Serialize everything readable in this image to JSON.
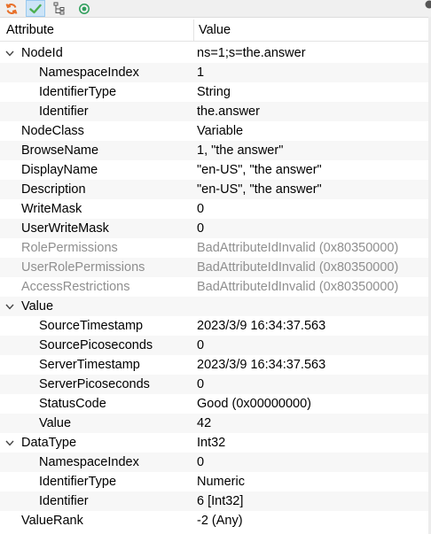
{
  "toolbar": {
    "buttons": [
      {
        "icon": "refresh-icon"
      },
      {
        "icon": "checkmark-icon",
        "active": true
      },
      {
        "icon": "tree-view-icon"
      },
      {
        "icon": "radio-target-icon"
      }
    ]
  },
  "header": {
    "attribute": "Attribute",
    "value": "Value"
  },
  "rows": [
    {
      "name": "NodeId",
      "value": "ns=1;s=the.answer",
      "level": 0,
      "expander": "expanded"
    },
    {
      "name": "NamespaceIndex",
      "value": "1",
      "level": 1
    },
    {
      "name": "IdentifierType",
      "value": "String",
      "level": 1
    },
    {
      "name": "Identifier",
      "value": "the.answer",
      "level": 1
    },
    {
      "name": "NodeClass",
      "value": "Variable",
      "level": 0
    },
    {
      "name": "BrowseName",
      "value": "1, \"the answer\"",
      "level": 0
    },
    {
      "name": "DisplayName",
      "value": "\"en-US\", \"the answer\"",
      "level": 0
    },
    {
      "name": "Description",
      "value": "\"en-US\", \"the answer\"",
      "level": 0
    },
    {
      "name": "WriteMask",
      "value": "0",
      "level": 0
    },
    {
      "name": "UserWriteMask",
      "value": "0",
      "level": 0
    },
    {
      "name": "RolePermissions",
      "value": "BadAttributeIdInvalid (0x80350000)",
      "level": 0,
      "disabled": true
    },
    {
      "name": "UserRolePermissions",
      "value": "BadAttributeIdInvalid (0x80350000)",
      "level": 0,
      "disabled": true
    },
    {
      "name": "AccessRestrictions",
      "value": "BadAttributeIdInvalid (0x80350000)",
      "level": 0,
      "disabled": true
    },
    {
      "name": "Value",
      "value": "",
      "level": 0,
      "expander": "expanded"
    },
    {
      "name": "SourceTimestamp",
      "value": "2023/3/9 16:34:37.563",
      "level": 1
    },
    {
      "name": "SourcePicoseconds",
      "value": "0",
      "level": 1
    },
    {
      "name": "ServerTimestamp",
      "value": "2023/3/9 16:34:37.563",
      "level": 1
    },
    {
      "name": "ServerPicoseconds",
      "value": "0",
      "level": 1
    },
    {
      "name": "StatusCode",
      "value": "Good (0x00000000)",
      "level": 1
    },
    {
      "name": "Value",
      "value": "42",
      "level": 1
    },
    {
      "name": "DataType",
      "value": "Int32",
      "level": 0,
      "expander": "expanded"
    },
    {
      "name": "NamespaceIndex",
      "value": "0",
      "level": 1
    },
    {
      "name": "IdentifierType",
      "value": "Numeric",
      "level": 1
    },
    {
      "name": "Identifier",
      "value": "6 [Int32]",
      "level": 1
    },
    {
      "name": "ValueRank",
      "value": "-2 (Any)",
      "level": 0
    }
  ],
  "colors": {
    "toolbar_bg": "#f0f0f0",
    "active_button_bg": "#cce4f7",
    "alt_row_bg": "#f7f7f7",
    "disabled_text": "#8f8f8f",
    "refresh_icon": "#e8702a",
    "check_icon": "#4caf50",
    "radio_icon": "#2e9e5b"
  }
}
